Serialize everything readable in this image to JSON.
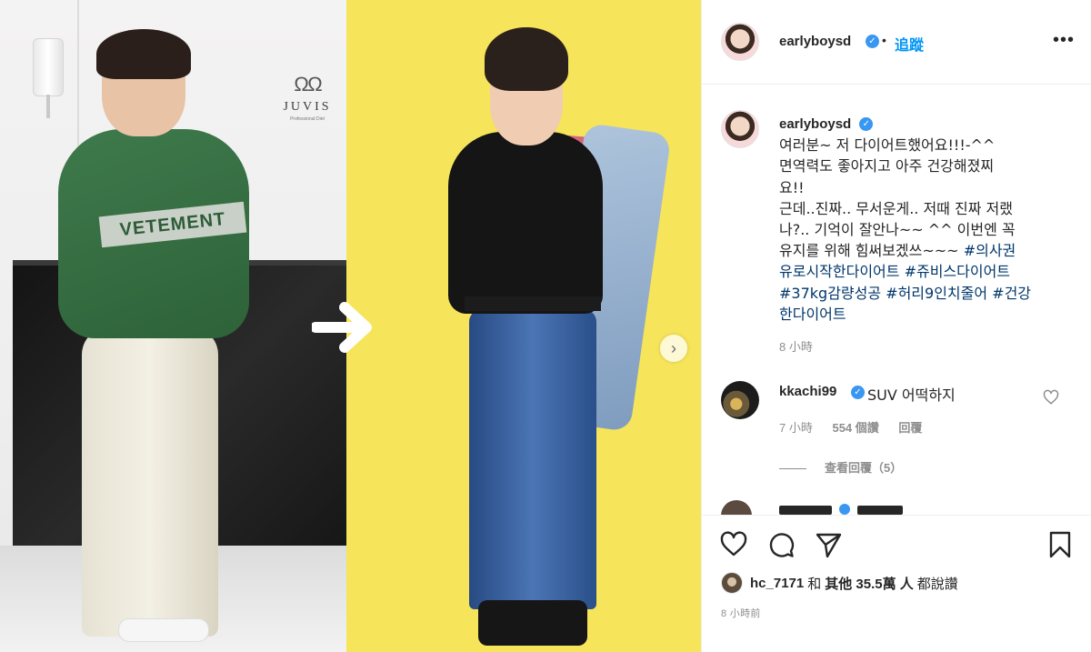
{
  "media": {
    "left_brand": "JUVIS",
    "left_brand_sub": "Professional Diet",
    "sweater_text": "VETEMENT",
    "next_label": "›"
  },
  "post": {
    "username": "earlyboysd",
    "follow_label": "追蹤",
    "more_label": "•••",
    "caption_lines": [
      "여러분~ 저 다이어트했어요!!!-^^",
      "면역력도 좋아지고 아주 건강해졌찌",
      "요!!",
      "근데..진짜.. 무서운게.. 저때 진짜 저랬",
      "나?.. 기억이 잘안나~~ ^^ 이번엔 꼭",
      "유지를 위해 힘써보겠쓰~~~ "
    ],
    "hashtags": [
      "#의사권",
      "유로시작한다이어트",
      "#쥬비스다이어트",
      "#37kg감량성공",
      "#허리9인치줄어",
      "#건강",
      "한다이어트"
    ],
    "time": "8 小時"
  },
  "comment": {
    "username": "kkachi99",
    "text": "SUV 어떡하지",
    "time": "7 小時",
    "likes": "554 個讚",
    "reply_label": "回覆",
    "view_replies": "查看回覆（5）"
  },
  "footer": {
    "liker": "hc_7171",
    "and_label": "和",
    "others_label": "其他 35.5萬 人",
    "likes_suffix": "都說讚",
    "timestamp": "8 小時前"
  },
  "colors": {
    "accent": "#0095f6",
    "verified": "#3897f0",
    "hashtag": "#00376b",
    "muted": "#8e8e8e",
    "yellow_backdrop": "#f6e45a"
  },
  "icons": [
    "verified-badge-icon",
    "more-options-icon",
    "next-arrow-icon",
    "heart-icon",
    "comment-icon",
    "share-icon",
    "bookmark-icon",
    "transition-arrow-icon"
  ]
}
